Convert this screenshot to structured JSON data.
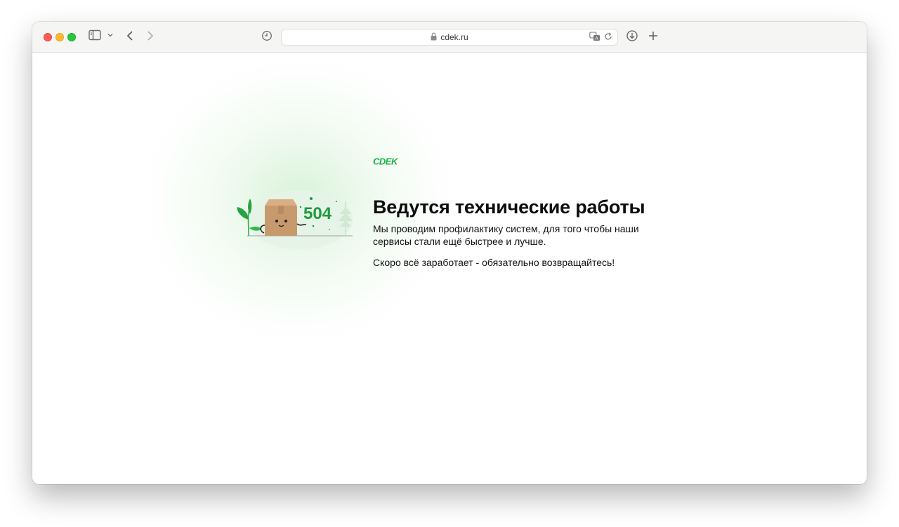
{
  "browser": {
    "url": "cdek.ru",
    "traffic_lights": [
      "close",
      "minimize",
      "maximize"
    ],
    "icons": {
      "sidebar": "sidebar-icon",
      "sidebar_menu": "chevron-down-icon",
      "back": "chevron-left-icon",
      "forward": "chevron-right-icon",
      "history": "clock-icon",
      "lock": "lock-icon",
      "translate": "translate-icon",
      "reload": "reload-icon",
      "downloads": "download-icon",
      "new_tab": "plus-icon"
    }
  },
  "page": {
    "logo_text": "CDEK",
    "error_code": "504",
    "title": "Ведутся технические работы",
    "paragraph1": "Мы проводим профилактику систем, для того чтобы наши сервисы стали ещё быстрее и лучше.",
    "paragraph2": "Скоро всё заработает - обязательно возвращайтесь!"
  },
  "colors": {
    "brand_green": "#1ab248",
    "code_green": "#1f9a3d",
    "box_brown": "#c79a6e"
  }
}
